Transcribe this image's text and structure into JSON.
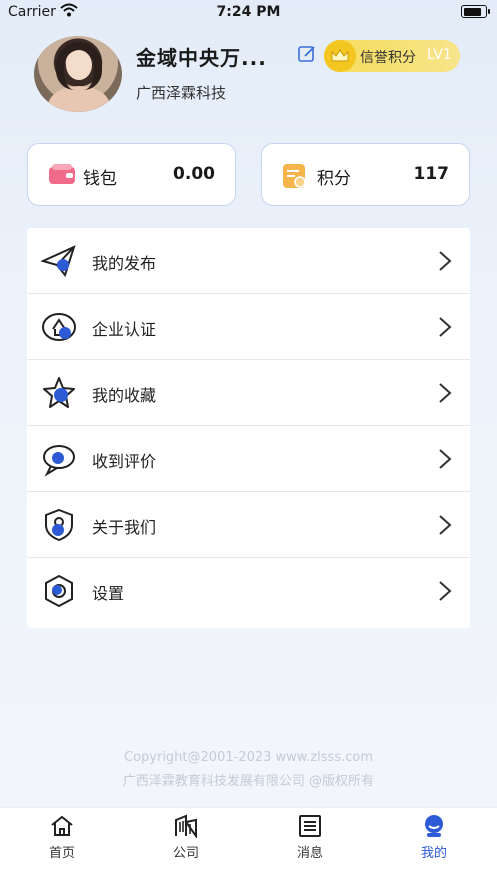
{
  "status_bar": {
    "carrier": "Carrier",
    "time": "7:24 PM"
  },
  "profile": {
    "name": "金域中央万...",
    "company": "广西泽霖科技",
    "credit_label": "信誉积分",
    "credit_level": "LV1"
  },
  "stats": {
    "wallet": {
      "label": "钱包",
      "value": "0.00"
    },
    "points": {
      "label": "积分",
      "value": "117"
    }
  },
  "menu": [
    {
      "label": "我的发布",
      "icon": "paper-plane-icon"
    },
    {
      "label": "企业认证",
      "icon": "enterprise-cert-icon"
    },
    {
      "label": "我的收藏",
      "icon": "star-icon"
    },
    {
      "label": "收到评价",
      "icon": "chat-bubble-icon"
    },
    {
      "label": "关于我们",
      "icon": "shield-user-icon"
    },
    {
      "label": "设置",
      "icon": "settings-hex-icon"
    }
  ],
  "footer": {
    "copyright": "Copyright@2001-2023 www.zlsss.com",
    "company": "广西泽霖教育科技发展有限公司 @版权所有"
  },
  "tabbar": [
    {
      "label": "首页",
      "icon": "home-icon"
    },
    {
      "label": "公司",
      "icon": "building-icon"
    },
    {
      "label": "消息",
      "icon": "message-list-icon"
    },
    {
      "label": "我的",
      "icon": "profile-icon",
      "active": true
    }
  ],
  "colors": {
    "accent": "#2d5bd6",
    "gold": "#f3c620"
  }
}
